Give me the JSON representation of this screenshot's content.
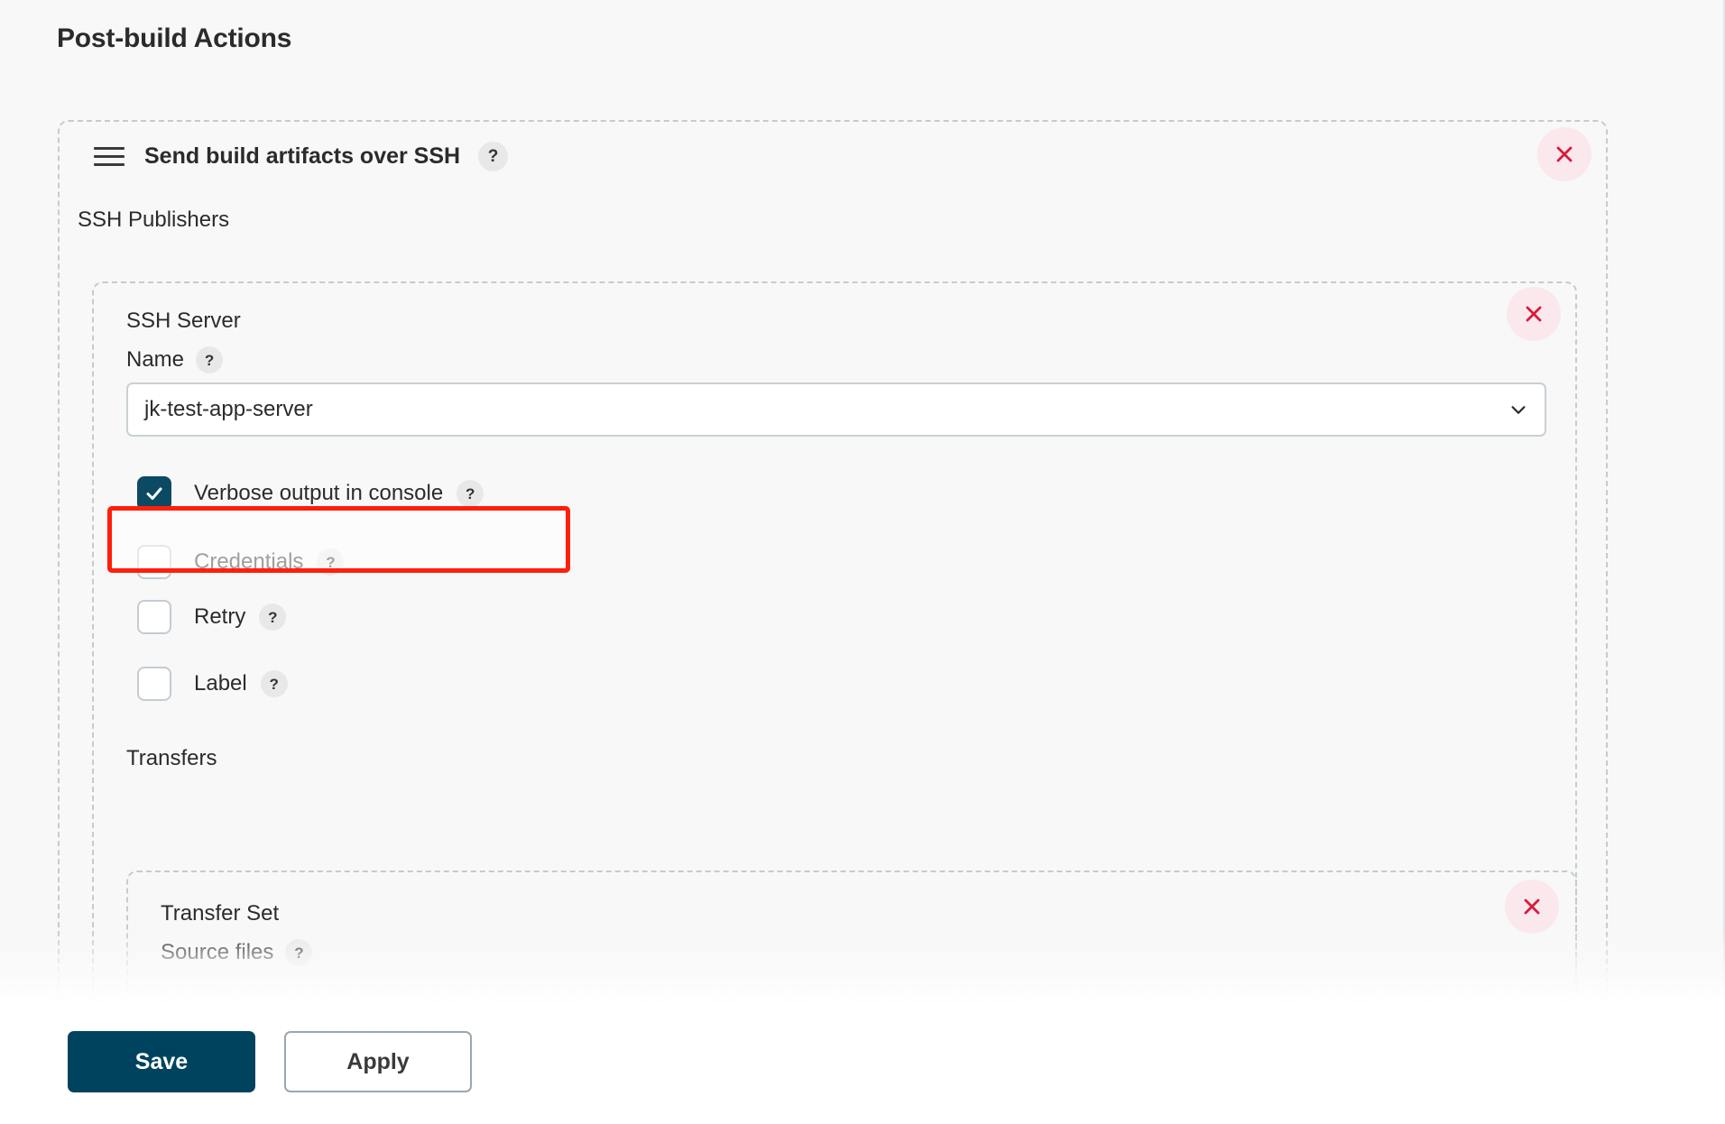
{
  "page": {
    "title": "Post-build Actions"
  },
  "post_build_block": {
    "drag_handle_icon": "hamburger-drag-icon",
    "title": "Send build artifacts over SSH",
    "help_icon": "?",
    "remove_icon": "close-x-icon",
    "publishers_label": "SSH Publishers"
  },
  "ssh_server": {
    "heading": "SSH Server",
    "name_label": "Name",
    "name_help": "?",
    "remove_icon": "close-x-icon",
    "selected_server": "jk-test-app-server",
    "dropdown_icon": "chevron-down-icon",
    "checkboxes": [
      {
        "label": "Verbose output in console",
        "help": "?",
        "checked": true,
        "highlighted": true
      },
      {
        "label": "Credentials",
        "help": "?",
        "checked": false,
        "highlighted": false
      },
      {
        "label": "Retry",
        "help": "?",
        "checked": false,
        "highlighted": false
      },
      {
        "label": "Label",
        "help": "?",
        "checked": false,
        "highlighted": false
      }
    ]
  },
  "transfers": {
    "heading": "Transfers",
    "transfer_set_heading": "Transfer Set",
    "source_files_label": "Source files",
    "source_files_help": "?",
    "remove_icon": "close-x-icon"
  },
  "footer": {
    "save_label": "Save",
    "apply_label": "Apply"
  },
  "colors": {
    "page_bg": "#f8f8f8",
    "accent_dark": "#00435e",
    "checkbox_checked": "#0c4a63",
    "dashed_border": "#c3ccd2",
    "close_bg": "#fae8ec",
    "close_x": "#d81b3c",
    "highlight_ring": "#ff1f0a",
    "text": "#2b2b2b"
  }
}
